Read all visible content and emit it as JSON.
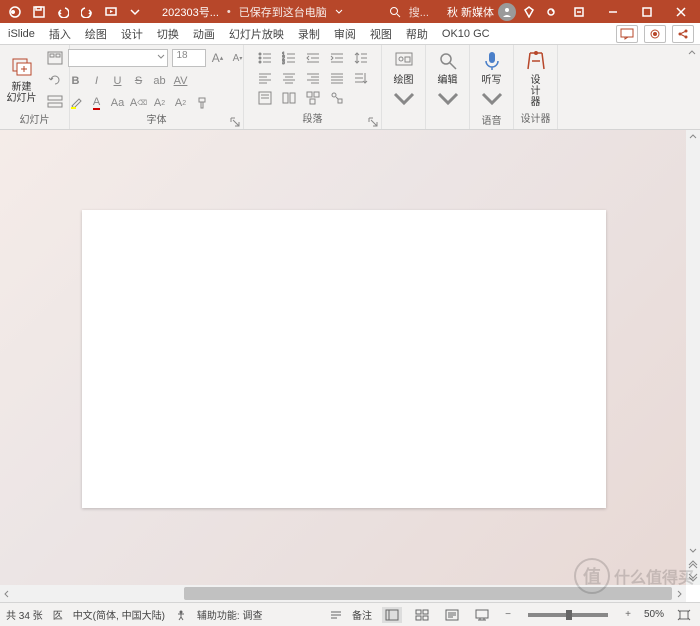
{
  "titlebar": {
    "filename": "202303号...",
    "save_status": "已保存到这台电脑",
    "search_placeholder": "搜...",
    "username": "秋 新媒体"
  },
  "tabs": {
    "items": [
      "iSlide",
      "插入",
      "绘图",
      "设计",
      "切换",
      "动画",
      "幻灯片放映",
      "录制",
      "审阅",
      "视图",
      "帮助",
      "OK10 GC"
    ]
  },
  "ribbon": {
    "slides": {
      "new_slide": "新建\n幻灯片",
      "group": "幻灯片"
    },
    "font": {
      "size": "18",
      "group": "字体"
    },
    "paragraph": {
      "group": "段落"
    },
    "drawing": {
      "label": "绘图",
      "group": ""
    },
    "editing": {
      "label": "编辑"
    },
    "dictate": {
      "label": "听写",
      "group": "语音"
    },
    "designer": {
      "label": "设\n计\n器",
      "group": "设计器"
    }
  },
  "status": {
    "slide_count": "共 34 张",
    "language": "中文(简体, 中国大陆)",
    "accessibility": "辅助功能: 调查",
    "notes": "备注",
    "zoom": "50%"
  },
  "watermark": {
    "char": "值",
    "text": "什么值得买"
  }
}
